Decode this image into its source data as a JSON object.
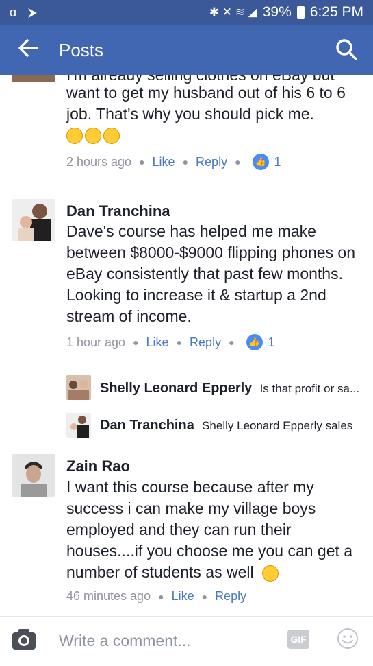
{
  "status_bar": {
    "left_icons": "ɑ ⮞",
    "signal_icons": "✱ ✕ ≋ ◢",
    "battery": "39%",
    "time": "6:25 PM"
  },
  "app_bar": {
    "title": "Posts"
  },
  "comments": [
    {
      "text_cut": "I'm already selling clothes on eBay but",
      "text": "want to get my husband out of his 6 to 6 job. That's why you should pick me.",
      "time": "2 hours ago",
      "like": "Like",
      "reply": "Reply",
      "likes": "1"
    },
    {
      "name": "Dan Tranchina",
      "text": "Dave's course has helped me  make between $8000-$9000 flipping phones on eBay consistently that past few months. Looking to increase it & startup a 2nd stream of income.",
      "time": "1 hour ago",
      "like": "Like",
      "reply": "Reply",
      "likes": "1",
      "replies": [
        {
          "name": "Shelly Leonard Epperly",
          "text": "Is that profit or sa..."
        },
        {
          "name": "Dan Tranchina",
          "text": "Shelly Leonard Epperly sales"
        }
      ]
    },
    {
      "name": "Zain Rao",
      "text": "I want this course because after my success i can make my village boys employed and they can run their houses....if you choose me you can get a number of students as well",
      "time": "46 minutes ago",
      "like": "Like",
      "reply": "Reply"
    }
  ],
  "composer": {
    "placeholder": "Write a comment...",
    "gif": "GIF"
  },
  "colors": {
    "brand": "#4267b2",
    "status": "#3b5998",
    "link": "#4a78c2",
    "meta": "#90949c"
  }
}
